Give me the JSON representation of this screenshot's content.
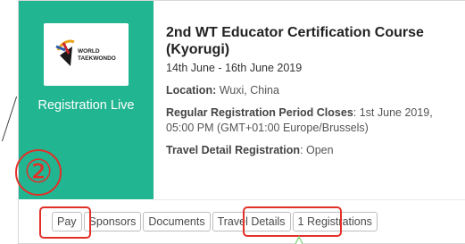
{
  "course": {
    "title": "2nd WT Educator Certification Course (Kyorugi)",
    "dates": "14th June - 16th June 2019",
    "location_label": "Location:",
    "location_value": "Wuxi, China",
    "reg_closes_label": "Regular Registration Period Closes",
    "reg_closes_value": ": 1st June 2019, 05:00 PM (GMT+01:00 Europe/Brussels)",
    "travel_label": "Travel Detail Registration",
    "travel_value": ": Open"
  },
  "sidebar": {
    "logo_line1": "WORLD",
    "logo_line2": "TAEKWONDO",
    "status": "Registration Live"
  },
  "annotation": {
    "step": "②",
    "color": "#e23028"
  },
  "buttons": [
    {
      "label": "Pay"
    },
    {
      "label": "Sponsors"
    },
    {
      "label": "Documents"
    },
    {
      "label": "Travel Details"
    },
    {
      "label": "1 Registrations"
    }
  ],
  "colors": {
    "accent_green": "#22b591",
    "highlight_red": "#e23028"
  },
  "icons": [
    "world-taekwondo-logo",
    "cursor-pointer-icon"
  ]
}
